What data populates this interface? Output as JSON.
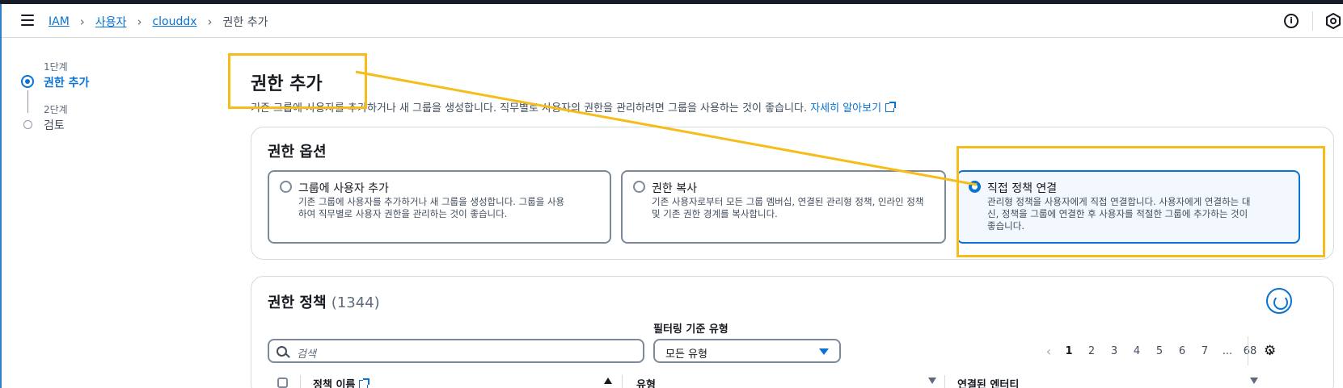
{
  "breadcrumb": {
    "items": [
      "IAM",
      "사용자",
      "clouddx"
    ],
    "current": "권한 추가"
  },
  "steps": [
    {
      "label": "1단계",
      "name": "권한 추가",
      "state": "active"
    },
    {
      "label": "2단계",
      "name": "검토",
      "state": "idle"
    }
  ],
  "header": {
    "title": "권한 추가",
    "description": "기존 그룹에 사용자를 추가하거나 새 그룹을 생성합니다. 직무별로 사용자의 권한을 관리하려면 그룹을 사용하는 것이 좋습니다.",
    "learn_more": "자세히 알아보기"
  },
  "options_card": {
    "title": "권한 옵션",
    "tiles": [
      {
        "title": "그룹에 사용자 추가",
        "desc_lines": [
          "기존 그룹에 사용자를 추가하거나 새 그룹을 생성합니다. 그룹을 사용",
          "하여 직무별로 사용자 권한을 관리하는 것이 좋습니다."
        ],
        "selected": false
      },
      {
        "title": "권한 복사",
        "desc_lines": [
          "기존 사용자로부터 모든 그룹 멤버십, 연결된 관리형 정책, 인라인 정책",
          "및 기존 권한 경계를 복사합니다."
        ],
        "selected": false
      },
      {
        "title": "직접 정책 연결",
        "desc_lines": [
          "관리형 정책을 사용자에게 직접 연결합니다. 사용자에게 연결하는 대",
          "신, 정책을 그룹에 연결한 후 사용자를 적절한 그룹에 추가하는 것이",
          "좋습니다."
        ],
        "selected": true
      }
    ]
  },
  "policies_card": {
    "title": "권한 정책",
    "count": "(1344)",
    "filter_label": "필터링 기준 유형",
    "search_placeholder": "검색",
    "filter_value": "모든 유형",
    "pages": [
      "1",
      "2",
      "3",
      "4",
      "5",
      "6",
      "7",
      "...",
      "68"
    ],
    "current_page": "1",
    "columns": [
      "정책 이름",
      "유형",
      "연결된 엔터티"
    ]
  },
  "icons": {
    "menu": "hamburger-icon",
    "info": "info-icon",
    "settings_top": "hexagon-icon",
    "external": "external-link-icon",
    "refresh": "refresh-icon",
    "search": "search-icon",
    "gear": "gear-icon"
  },
  "colors": {
    "accent": "#0972d3",
    "annotation": "#f6bd1a",
    "topstrip": "#161d26"
  }
}
